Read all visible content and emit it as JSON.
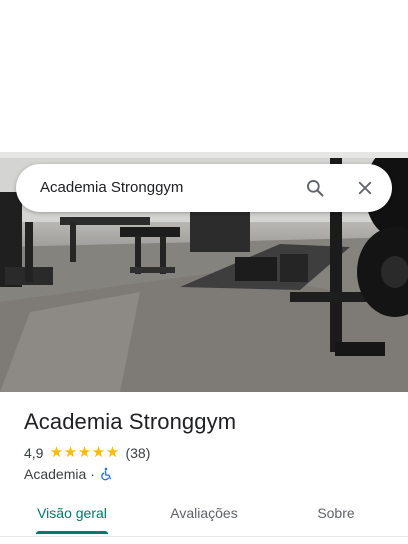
{
  "search": {
    "query": "Academia Stronggym"
  },
  "place": {
    "name": "Academia Stronggym",
    "rating": "4,9",
    "stars": 5,
    "review_count": "(38)",
    "category": "Academia",
    "separator": "·",
    "accessibility_icon": "wheelchair-icon"
  },
  "tabs": [
    {
      "label": "Visão geral",
      "active": true
    },
    {
      "label": "Avaliações",
      "active": false
    },
    {
      "label": "Sobre",
      "active": false
    }
  ],
  "colors": {
    "accent": "#00796b",
    "star": "#fbbc04",
    "accessibility": "#1a73e8"
  }
}
